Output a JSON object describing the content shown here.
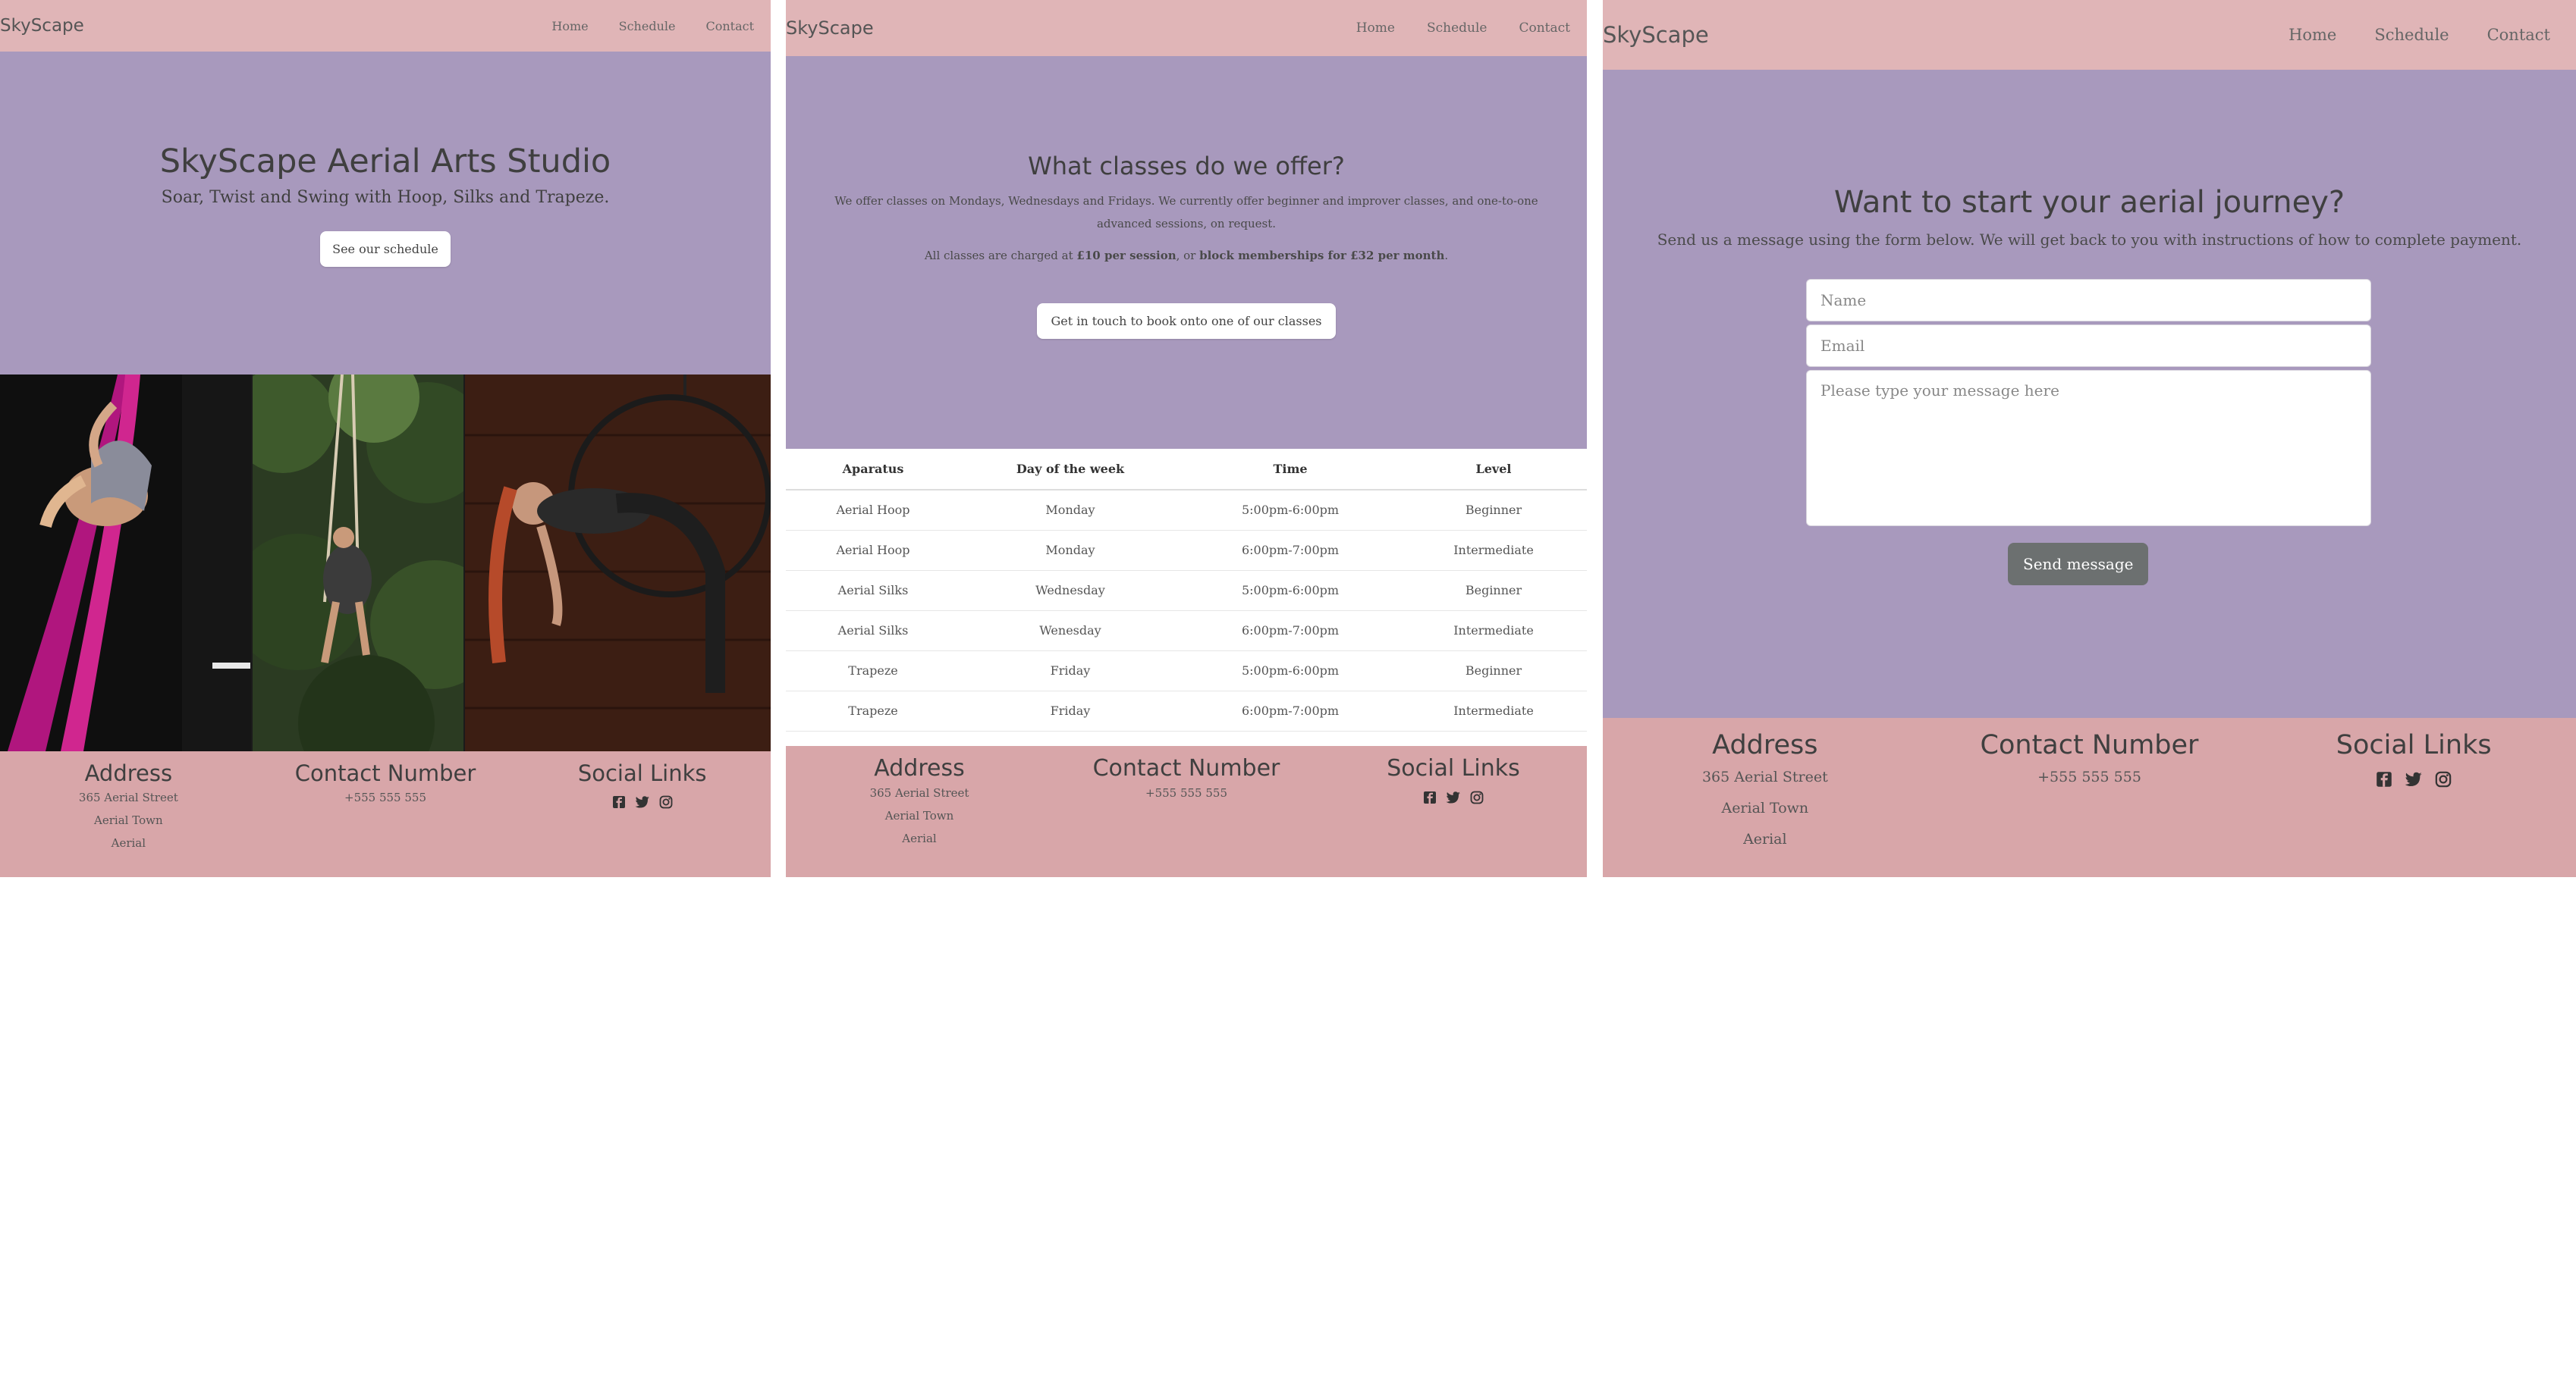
{
  "site": {
    "brand": "SkyScape"
  },
  "nav": {
    "home": "Home",
    "schedule": "Schedule",
    "contact": "Contact"
  },
  "home": {
    "title": "SkyScape Aerial Arts Studio",
    "subtitle": "Soar, Twist and Swing with Hoop, Silks and Trapeze.",
    "cta": "See our schedule"
  },
  "schedule": {
    "title": "What classes do we offer?",
    "intro": "We offer classes on Mondays, Wednesdays and Fridays. We currently offer beginner and improver classes, and one-to-one advanced sessions, on request.",
    "price_prefix": "All classes are charged at ",
    "price_session": "£10 per session",
    "price_mid": ", or ",
    "price_block": "block memberships for £32 per month",
    "price_suffix": ".",
    "cta": "Get in touch to book onto one of our classes",
    "table_headers": [
      "Aparatus",
      "Day of the week",
      "Time",
      "Level"
    ],
    "rows": [
      [
        "Aerial Hoop",
        "Monday",
        "5:00pm-6:00pm",
        "Beginner"
      ],
      [
        "Aerial Hoop",
        "Monday",
        "6:00pm-7:00pm",
        "Intermediate"
      ],
      [
        "Aerial Silks",
        "Wednesday",
        "5:00pm-6:00pm",
        "Beginner"
      ],
      [
        "Aerial Silks",
        "Wenesday",
        "6:00pm-7:00pm",
        "Intermediate"
      ],
      [
        "Trapeze",
        "Friday",
        "5:00pm-6:00pm",
        "Beginner"
      ],
      [
        "Trapeze",
        "Friday",
        "6:00pm-7:00pm",
        "Intermediate"
      ]
    ]
  },
  "contact": {
    "title": "Want to start your aerial journey?",
    "intro": "Send us a message using the form below. We will get back to you with instructions of how to complete payment.",
    "name_placeholder": "Name",
    "email_placeholder": "Email",
    "message_placeholder": "Please type your message here",
    "send": "Send message"
  },
  "footer": {
    "address_title": "Address",
    "address_lines": [
      "365 Aerial Street",
      "Aerial Town",
      "Aerial"
    ],
    "phone_title": "Contact Number",
    "phone": "+555 555 555",
    "social_title": "Social Links",
    "icons": [
      "facebook-icon",
      "twitter-icon",
      "instagram-icon"
    ]
  },
  "colors": {
    "nav": "#e0b5b7",
    "hero": "#a899bd",
    "footer": "#d8a6a9",
    "send_button": "#6c7070"
  }
}
